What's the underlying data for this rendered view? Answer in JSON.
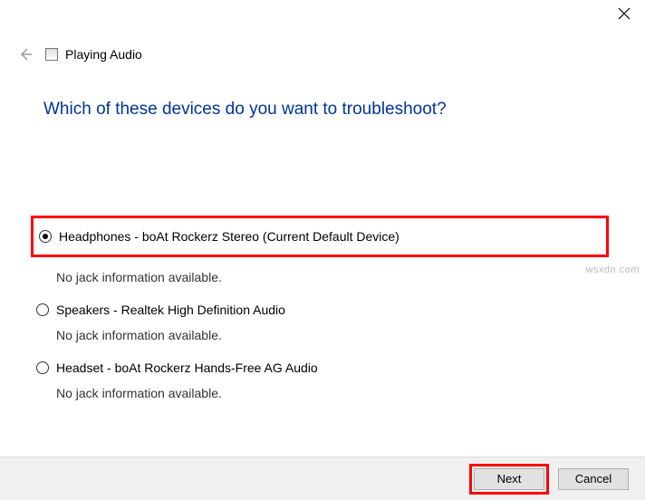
{
  "header": {
    "window_title": "Playing Audio"
  },
  "main": {
    "heading": "Which of these devices do you want to troubleshoot?",
    "devices": [
      {
        "label": "Headphones - boAt Rockerz Stereo (Current Default Device)",
        "info": "No jack information available.",
        "selected": true,
        "highlighted": true
      },
      {
        "label": "Speakers - Realtek High Definition Audio",
        "info": "No jack information available.",
        "selected": false,
        "highlighted": false
      },
      {
        "label": "Headset - boAt Rockerz Hands-Free AG Audio",
        "info": "No jack information available.",
        "selected": false,
        "highlighted": false
      }
    ]
  },
  "footer": {
    "next_label": "Next",
    "cancel_label": "Cancel"
  },
  "watermark": "wsxdn.com"
}
